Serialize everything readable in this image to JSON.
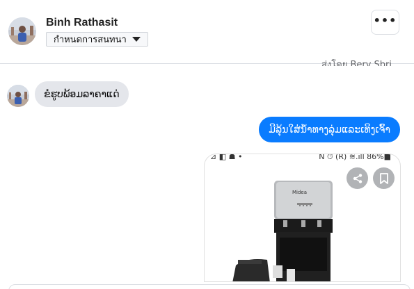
{
  "header": {
    "contact_name": "Binh Rathasit",
    "chat_settings_label": "กำหนดการสนทนา",
    "more_label": "•••"
  },
  "notice": {
    "cut_text": "ส่งโดย Bery Sbri..."
  },
  "messages": [
    {
      "direction": "incoming",
      "text": "ຂໍຮູບພ້ອມລາຄາແດ່"
    },
    {
      "direction": "outgoing",
      "text": "ມີລຸ້ນໃສ່ນ້ຳທາງລຸ່ມແລະເທິງເຈົ້າ"
    }
  ],
  "photo": {
    "status_left": "⊿ ◧ ☗ •",
    "status_right": "N ⏱ (R) ≋.ıll 86%■",
    "product_brand": "Midea",
    "share_icon": "share-icon",
    "bookmark_icon": "bookmark-icon"
  },
  "colors": {
    "outgoing_bubble": "#0a7cff",
    "incoming_bubble": "#e4e6eb"
  }
}
